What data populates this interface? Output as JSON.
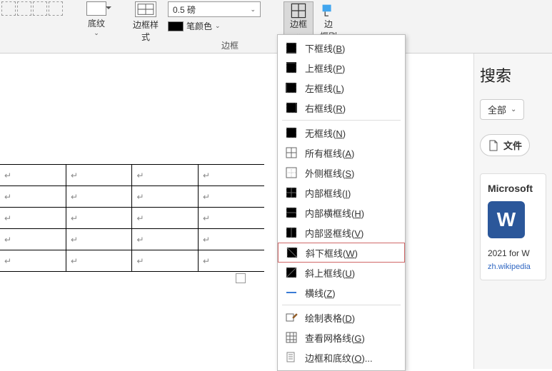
{
  "ribbon": {
    "shading_label": "底纹",
    "border_style_label": "边框样\n式",
    "weight_value": "0.5 磅",
    "pen_color_label": "笔颜色",
    "borders_btn_label": "边框",
    "border_painter_label": "边\n框刷",
    "group_label": "边框"
  },
  "menu": {
    "items": [
      {
        "icon": "border-bottom-icon",
        "label": "下框线",
        "mn": "B"
      },
      {
        "icon": "border-top-icon",
        "label": "上框线",
        "mn": "P"
      },
      {
        "icon": "border-left-icon",
        "label": "左框线",
        "mn": "L"
      },
      {
        "icon": "border-right-icon",
        "label": "右框线",
        "mn": "R"
      },
      {
        "sep": true
      },
      {
        "icon": "border-none-icon",
        "label": "无框线",
        "mn": "N"
      },
      {
        "icon": "border-all-icon",
        "label": "所有框线",
        "mn": "A"
      },
      {
        "icon": "border-outside-icon",
        "label": "外侧框线",
        "mn": "S"
      },
      {
        "icon": "border-inside-icon",
        "label": "内部框线",
        "mn": "I"
      },
      {
        "icon": "border-inside-h-icon",
        "label": "内部横框线",
        "mn": "H"
      },
      {
        "icon": "border-inside-v-icon",
        "label": "内部竖框线",
        "mn": "V"
      },
      {
        "icon": "border-diag-down-icon",
        "label": "斜下框线",
        "mn": "W",
        "highlight": true
      },
      {
        "icon": "border-diag-up-icon",
        "label": "斜上框线",
        "mn": "U"
      },
      {
        "icon": "horizontal-line-icon",
        "label": "横线",
        "mn": "Z"
      },
      {
        "sep": true
      },
      {
        "icon": "draw-table-icon",
        "label": "绘制表格",
        "mn": "D"
      },
      {
        "icon": "view-gridlines-icon",
        "label": "查看网格线",
        "mn": "G"
      },
      {
        "icon": "borders-shading-icon",
        "label": "边框和底纹",
        "mn": "O",
        "ellipsis": true
      }
    ]
  },
  "table": {
    "cell_mark": "↵",
    "rows": 5,
    "cols": 4
  },
  "search": {
    "title": "搜索",
    "scope_label": "全部",
    "file_chip_label": "文件",
    "result_title": "Microsoft",
    "result_sub": "2021 for W",
    "result_link": "zh.wikipedia"
  }
}
